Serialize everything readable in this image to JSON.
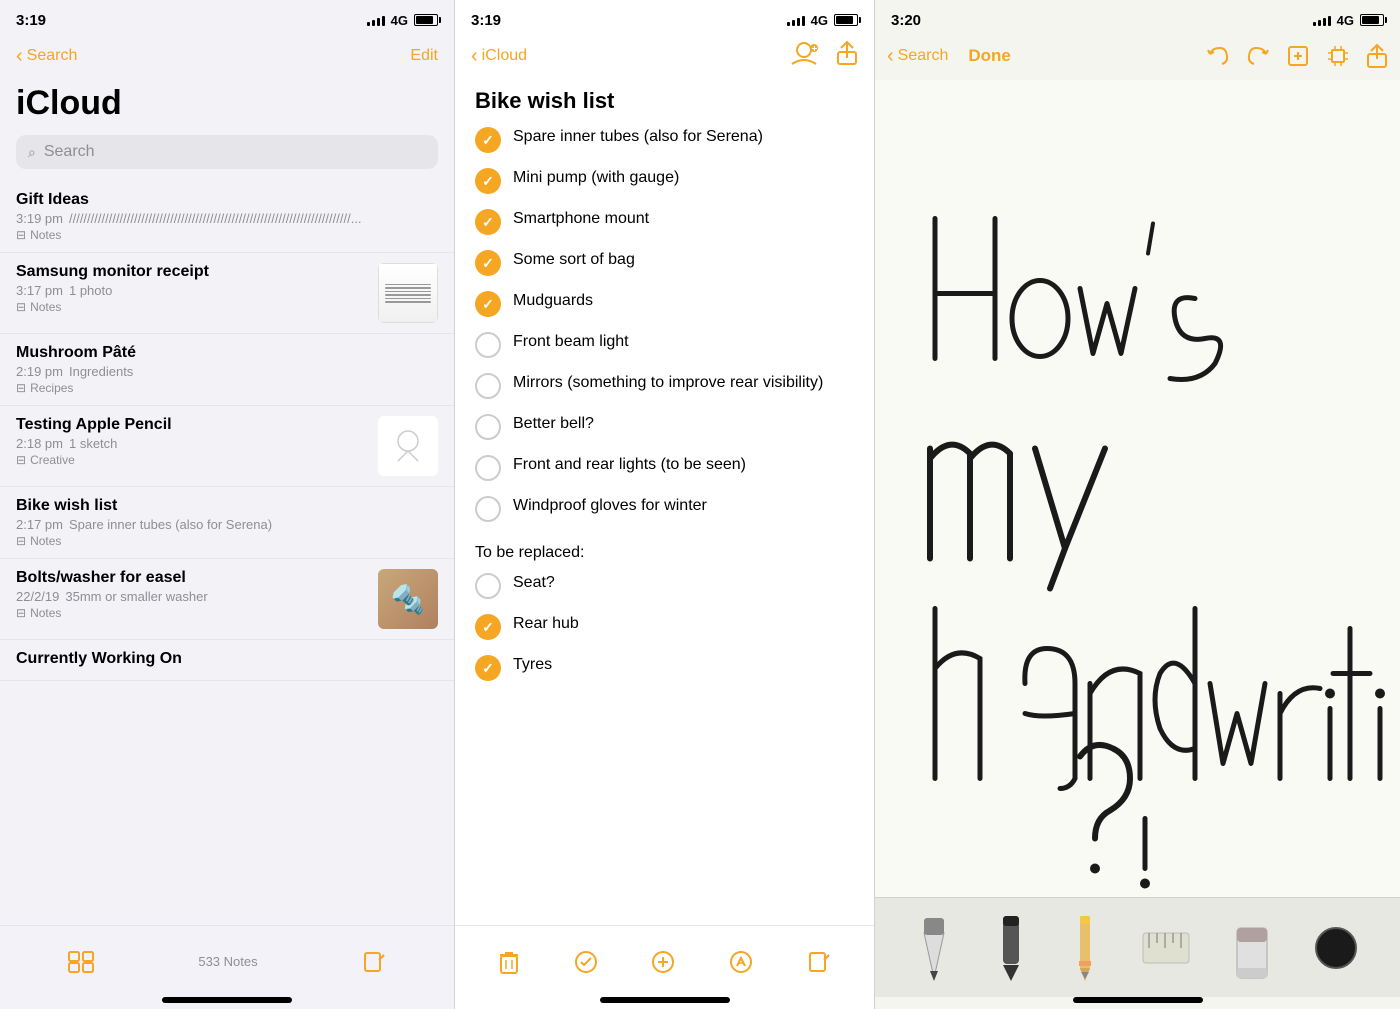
{
  "panels": {
    "left": {
      "status": {
        "time": "3:19",
        "network": "4G"
      },
      "nav": {
        "back": "Search",
        "title": "iCloud",
        "action": "Edit"
      },
      "search": {
        "placeholder": "Search"
      },
      "notes": [
        {
          "id": "gift-ideas",
          "title": "Gift Ideas",
          "time": "3:19 pm",
          "preview": "////////////////////////////////////////////////////////////////////////////////...",
          "folder": "Notes",
          "thumbnail": null
        },
        {
          "id": "samsung-receipt",
          "title": "Samsung monitor receipt",
          "time": "3:17 pm",
          "meta": "1 photo",
          "folder": "Notes",
          "thumbnail": "receipt"
        },
        {
          "id": "mushroom-pate",
          "title": "Mushroom Pâté",
          "time": "2:19 pm",
          "preview": "Ingredients",
          "folder": "Recipes",
          "thumbnail": null
        },
        {
          "id": "testing-pencil",
          "title": "Testing Apple Pencil",
          "time": "2:18 pm",
          "meta": "1 sketch",
          "folder": "Creative",
          "thumbnail": "sketch"
        },
        {
          "id": "bike-wish",
          "title": "Bike wish list",
          "time": "2:17 pm",
          "preview": "Spare inner tubes (also for Serena)",
          "folder": "Notes",
          "thumbnail": null
        },
        {
          "id": "bolts-washer",
          "title": "Bolts/washer for easel",
          "time": "22/2/19",
          "preview": "35mm or smaller washer",
          "folder": "Notes",
          "thumbnail": "bolts"
        },
        {
          "id": "currently-working",
          "title": "Currently Working On",
          "time": "",
          "preview": "",
          "folder": "",
          "thumbnail": null
        }
      ],
      "bottom": {
        "count": "533 Notes"
      }
    },
    "mid": {
      "status": {
        "time": "3:19",
        "network": "4G"
      },
      "nav": {
        "back": "iCloud"
      },
      "note_title": "Bike wish list",
      "sections": [
        {
          "header": null,
          "items": [
            {
              "checked": true,
              "text": "Spare inner tubes (also for Serena)"
            },
            {
              "checked": true,
              "text": "Mini pump (with gauge)"
            },
            {
              "checked": true,
              "text": "Smartphone mount"
            },
            {
              "checked": true,
              "text": "Some sort of bag"
            },
            {
              "checked": true,
              "text": "Mudguards"
            },
            {
              "checked": false,
              "text": "Front beam light"
            },
            {
              "checked": false,
              "text": "Mirrors (something to improve rear visibility)"
            },
            {
              "checked": false,
              "text": "Better bell?"
            },
            {
              "checked": false,
              "text": "Front and rear lights (to be seen)"
            },
            {
              "checked": false,
              "text": "Windproof gloves for winter"
            }
          ]
        },
        {
          "header": "To be replaced:",
          "items": [
            {
              "checked": false,
              "text": "Seat?"
            },
            {
              "checked": true,
              "text": "Rear hub"
            },
            {
              "checked": true,
              "text": "Tyres"
            }
          ]
        }
      ]
    },
    "right": {
      "status": {
        "time": "3:20",
        "network": "4G"
      },
      "nav": {
        "done": "Done",
        "back": "Search"
      },
      "handwriting_text": "How's my handwriting?",
      "tools": [
        "pen",
        "marker",
        "pencil",
        "ruler",
        "eraser",
        "circle-color"
      ]
    }
  }
}
